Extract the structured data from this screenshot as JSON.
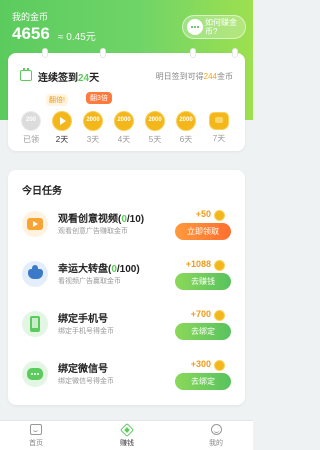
{
  "header": {
    "label": "我的金币",
    "coins": "4656",
    "money": "≈ 0.45元",
    "earn_button": "如何赚金币?",
    "gradient_start": "#5ccb5e",
    "gradient_end": "#9ee04f"
  },
  "sign_in": {
    "title_prefix": "连续签到",
    "days": "24",
    "title_suffix": "天",
    "tip_prefix": "明日签到可得",
    "tip_amount": "244",
    "tip_suffix": "金币",
    "tag_fanbei": "翻倍!",
    "tag_fan3": "翻3倍",
    "days_list": [
      {
        "value": "200",
        "label": "已领",
        "state": "done"
      },
      {
        "value": "",
        "label": "2天",
        "state": "play"
      },
      {
        "value": "2000",
        "label": "3天",
        "state": "coin"
      },
      {
        "value": "2000",
        "label": "4天",
        "state": "coin"
      },
      {
        "value": "2000",
        "label": "5天",
        "state": "coin"
      },
      {
        "value": "2000",
        "label": "6天",
        "state": "coin"
      },
      {
        "value": "",
        "label": "7天",
        "state": "bag"
      }
    ]
  },
  "tasks": {
    "title": "今日任务",
    "items": [
      {
        "name": "观看创意视频",
        "progress_open": "(",
        "progress_done": "0",
        "progress_rest": "/10)",
        "desc": "观看创意广告赚取金币",
        "reward": "+50",
        "button": "立即领取",
        "icon": "video-icon"
      },
      {
        "name": "幸运大转盘",
        "progress_open": "(",
        "progress_done": "0",
        "progress_rest": "/100)",
        "desc": "看视频广告赢取金币",
        "reward": "+1088",
        "button": "去赚钱",
        "icon": "lucky-wheel-icon"
      },
      {
        "name": "绑定手机号",
        "progress_open": "",
        "progress_done": "",
        "progress_rest": "",
        "desc": "绑定手机号得金币",
        "reward": "+700",
        "button": "去绑定",
        "icon": "phone-icon"
      },
      {
        "name": "绑定微信号",
        "progress_open": "",
        "progress_done": "",
        "progress_rest": "",
        "desc": "绑定微信号得金币",
        "reward": "+300",
        "button": "去绑定",
        "icon": "wechat-icon"
      }
    ]
  },
  "tabbar": {
    "home": "首页",
    "earn": "赚钱",
    "mine": "我的"
  },
  "colors": {
    "accent_green": "#5ccb5e",
    "accent_orange": "#ff7a3d",
    "coin_gold": "#f3b71b"
  }
}
